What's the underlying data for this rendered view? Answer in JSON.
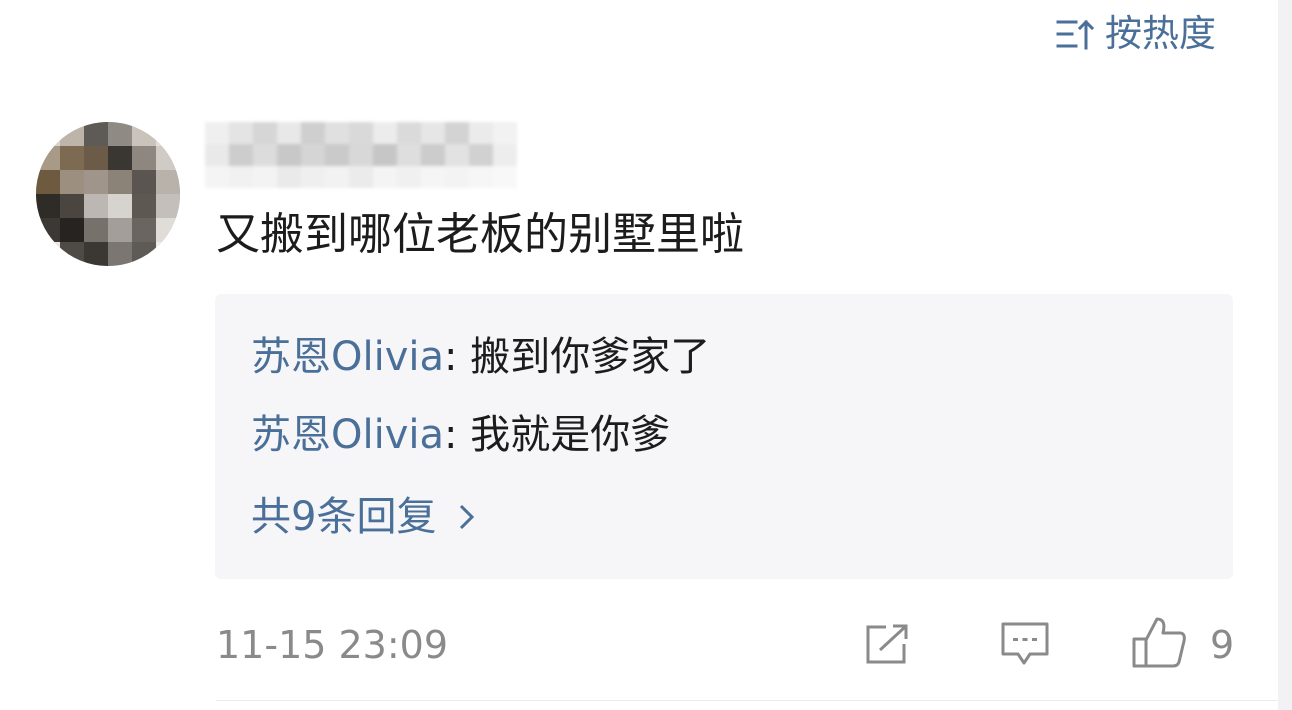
{
  "colors": {
    "link": "#4a6f98",
    "text": "#1c1c1c",
    "muted": "#8a8a8a",
    "reply_background": "#f6f6f8"
  },
  "sort": {
    "label": "按热度",
    "icon": "sort-icon"
  },
  "comment": {
    "avatar": "pixelated-avatar",
    "username": "",
    "text": "又搬到哪位老板的别墅里啦"
  },
  "replies": [
    {
      "user": "苏恩Olivia",
      "separator": ":",
      "text": "搬到你爹家了"
    },
    {
      "user": "苏恩Olivia",
      "separator": ":",
      "text": "我就是你爹"
    }
  ],
  "more_replies": {
    "label": "共9条回复",
    "icon": "chevron-right-icon"
  },
  "footer": {
    "timestamp": "11-15 23:09",
    "share_icon": "share-icon",
    "comment_icon": "comment-icon",
    "like_icon": "thumbs-up-icon",
    "like_count": "9"
  }
}
